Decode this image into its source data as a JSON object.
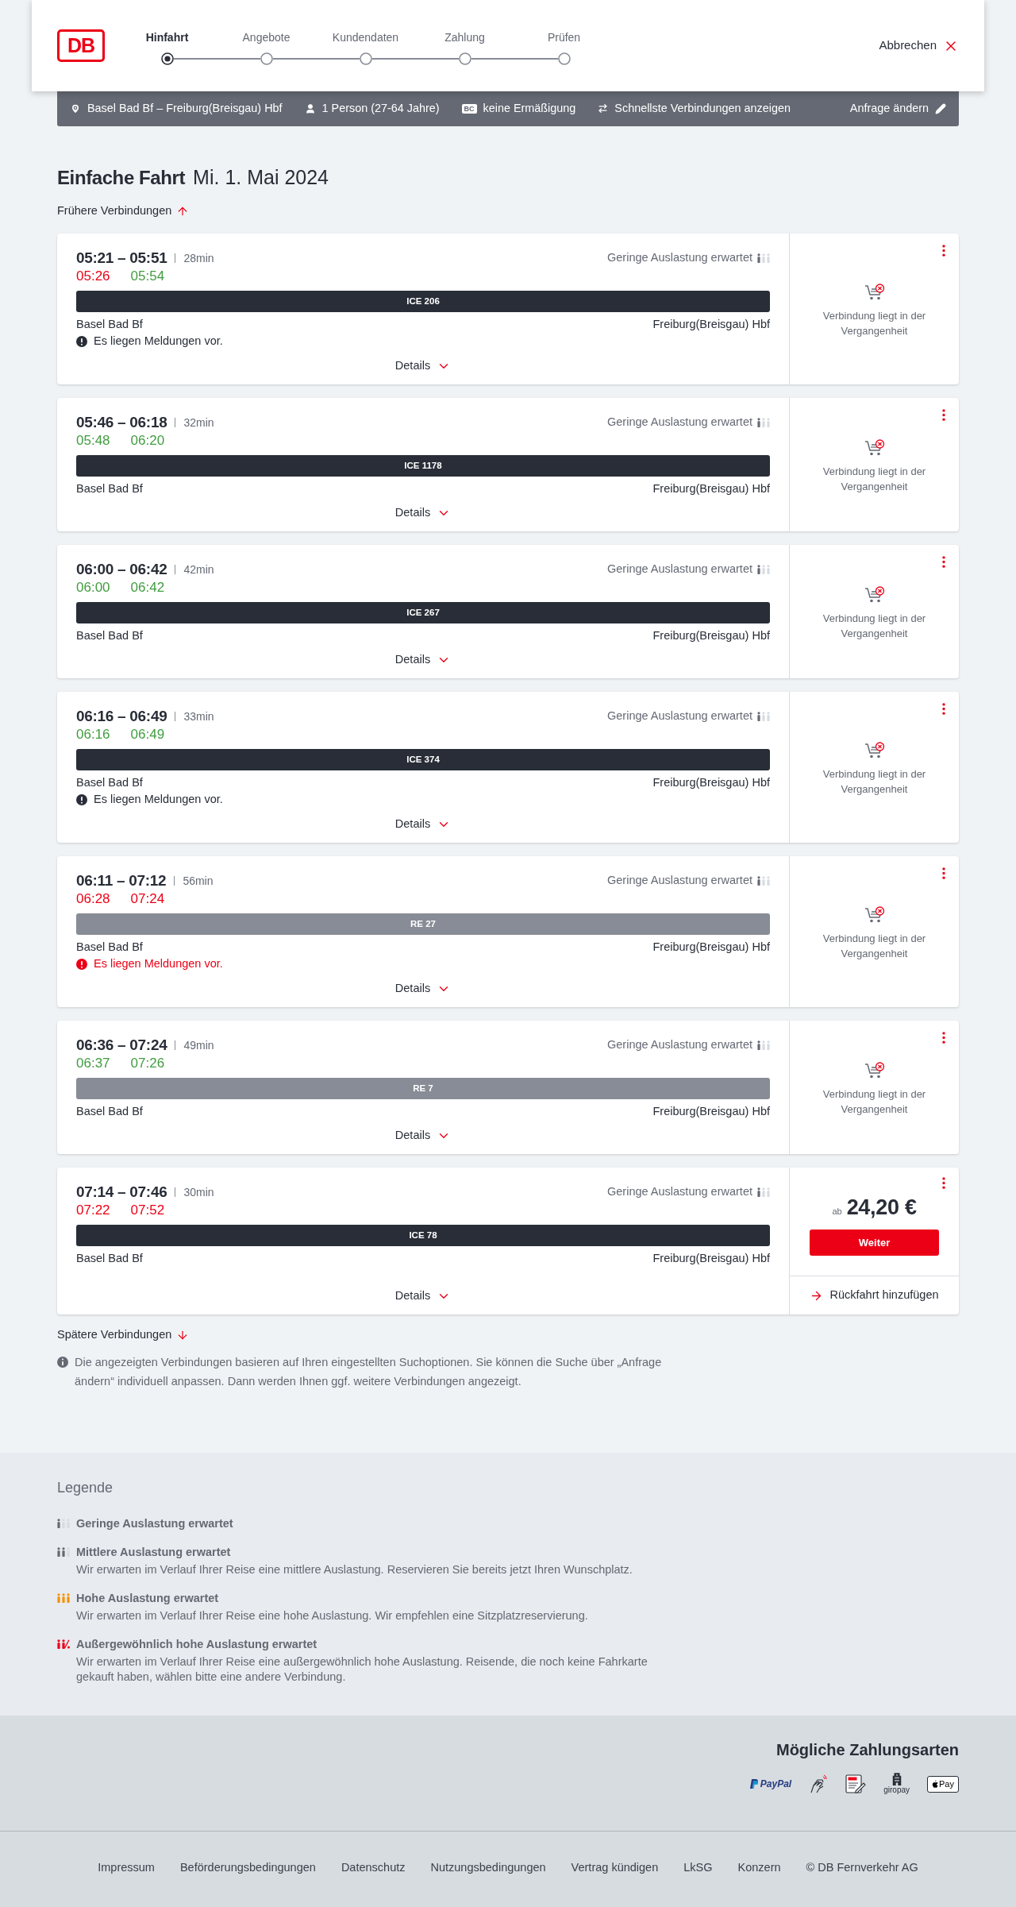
{
  "header": {
    "logo": "DB",
    "steps": [
      {
        "label": "Hinfahrt",
        "selected": true
      },
      {
        "label": "Angebote",
        "selected": false
      },
      {
        "label": "Kundendaten",
        "selected": false
      },
      {
        "label": "Zahlung",
        "selected": false
      },
      {
        "label": "Prüfen",
        "selected": false
      }
    ],
    "cancel": "Abbrechen"
  },
  "search_summary": {
    "route": "Basel Bad Bf – Freiburg(Breisgau) Hbf",
    "passengers": "1 Person (27-64 Jahre)",
    "discount_badge": "BC",
    "discount": "keine Ermäßigung",
    "option": "Schnellste Verbindungen anzeigen",
    "edit": "Anfrage ändern"
  },
  "heading": {
    "title": "Einfache Fahrt",
    "date": "Mi. 1. Mai 2024"
  },
  "earlier_link": "Frühere Verbindungen",
  "connections": [
    {
      "times": "05:21 – 05:51",
      "duration": "28min",
      "realtime": [
        {
          "time": "05:26",
          "late": true
        },
        {
          "time": "05:54",
          "late": false
        }
      ],
      "occupancy": {
        "kind": "low",
        "text": "Geringe Auslastung erwartet"
      },
      "train": {
        "kind": "long_distance",
        "label": "ICE 206"
      },
      "from": "Basel Bad Bf",
      "to": "Freiburg(Breisgau) Hbf",
      "message": {
        "text": "Es liegen Meldungen vor.",
        "alert": false
      },
      "details": "Details",
      "offer": {
        "kind": "past",
        "text": "Verbindung liegt in der Vergangenheit"
      }
    },
    {
      "times": "05:46 – 06:18",
      "duration": "32min",
      "realtime": [
        {
          "time": "05:48",
          "late": false
        },
        {
          "time": "06:20",
          "late": false
        }
      ],
      "occupancy": {
        "kind": "low",
        "text": "Geringe Auslastung erwartet"
      },
      "train": {
        "kind": "long_distance",
        "label": "ICE 1178"
      },
      "from": "Basel Bad Bf",
      "to": "Freiburg(Breisgau) Hbf",
      "details": "Details",
      "offer": {
        "kind": "past",
        "text": "Verbindung liegt in der Vergangenheit"
      }
    },
    {
      "times": "06:00 – 06:42",
      "duration": "42min",
      "realtime": [
        {
          "time": "06:00",
          "late": false
        },
        {
          "time": "06:42",
          "late": false
        }
      ],
      "occupancy": {
        "kind": "low",
        "text": "Geringe Auslastung erwartet"
      },
      "train": {
        "kind": "long_distance",
        "label": "ICE 267"
      },
      "from": "Basel Bad Bf",
      "to": "Freiburg(Breisgau) Hbf",
      "details": "Details",
      "offer": {
        "kind": "past",
        "text": "Verbindung liegt in der Vergangenheit"
      }
    },
    {
      "times": "06:16 – 06:49",
      "duration": "33min",
      "realtime": [
        {
          "time": "06:16",
          "late": false
        },
        {
          "time": "06:49",
          "late": false
        }
      ],
      "occupancy": {
        "kind": "low",
        "text": "Geringe Auslastung erwartet"
      },
      "train": {
        "kind": "long_distance",
        "label": "ICE 374"
      },
      "from": "Basel Bad Bf",
      "to": "Freiburg(Breisgau) Hbf",
      "message": {
        "text": "Es liegen Meldungen vor.",
        "alert": false
      },
      "details": "Details",
      "offer": {
        "kind": "past",
        "text": "Verbindung liegt in der Vergangenheit"
      }
    },
    {
      "times": "06:11 – 07:12",
      "duration": "56min",
      "realtime": [
        {
          "time": "06:28",
          "late": true
        },
        {
          "time": "07:24",
          "late": true
        }
      ],
      "occupancy": {
        "kind": "low",
        "text": "Geringe Auslastung erwartet"
      },
      "train": {
        "kind": "regional",
        "label": "RE 27"
      },
      "from": "Basel Bad Bf",
      "to": "Freiburg(Breisgau) Hbf",
      "message": {
        "text": "Es liegen Meldungen vor.",
        "alert": true
      },
      "details": "Details",
      "offer": {
        "kind": "past",
        "text": "Verbindung liegt in der Vergangenheit"
      }
    },
    {
      "times": "06:36 – 07:24",
      "duration": "49min",
      "realtime": [
        {
          "time": "06:37",
          "late": false
        },
        {
          "time": "07:26",
          "late": false
        }
      ],
      "occupancy": {
        "kind": "low",
        "text": "Geringe Auslastung erwartet"
      },
      "train": {
        "kind": "regional",
        "label": "RE 7"
      },
      "from": "Basel Bad Bf",
      "to": "Freiburg(Breisgau) Hbf",
      "details": "Details",
      "offer": {
        "kind": "past",
        "text": "Verbindung liegt in der Vergangenheit"
      }
    },
    {
      "times": "07:14 – 07:46",
      "duration": "30min",
      "realtime": [
        {
          "time": "07:22",
          "late": true
        },
        {
          "time": "07:52",
          "late": true
        }
      ],
      "occupancy": {
        "kind": "low",
        "text": "Geringe Auslastung erwartet"
      },
      "train": {
        "kind": "long_distance",
        "label": "ICE 78"
      },
      "from": "Basel Bad Bf",
      "to": "Freiburg(Breisgau) Hbf",
      "details": "Details",
      "offer": {
        "kind": "price",
        "prefix": "ab",
        "price": "24,20 €",
        "button": "Weiter",
        "return_link": "Rückfahrt hinzufügen"
      }
    }
  ],
  "later_link": "Spätere Verbindungen",
  "note": "Die angezeigten Verbindungen basieren auf Ihren eingestellten Suchoptionen. Sie können die Suche über „Anfrage ändern“ individuell anpassen. Dann werden Ihnen ggf. weitere Verbindungen angezeigt.",
  "legend": {
    "title": "Legende",
    "items": [
      {
        "kind": "low",
        "title": "Geringe Auslastung erwartet"
      },
      {
        "kind": "medium",
        "title": "Mittlere Auslastung erwartet",
        "description": "Wir erwarten im Verlauf Ihrer Reise eine mittlere Auslastung. Reservieren Sie bereits jetzt Ihren Wunschplatz."
      },
      {
        "kind": "high",
        "title": "Hohe Auslastung erwartet",
        "description": "Wir erwarten im Verlauf Ihrer Reise eine hohe Auslastung. Wir empfehlen eine Sitzplatzreservierung."
      },
      {
        "kind": "extreme",
        "title": "Außergewöhnlich hohe Auslastung erwartet",
        "description": "Wir erwarten im Verlauf Ihrer Reise eine außergewöhnlich hohe Auslastung. Reisende, die noch keine Fahrkarte gekauft haben, wählen bitte eine andere Verbindung."
      }
    ]
  },
  "footer": {
    "payment_title": "Mögliche Zahlungsarten",
    "payment_methods": [
      {
        "kind": "paypal",
        "label": "PayPal"
      },
      {
        "kind": "contactless"
      },
      {
        "kind": "sepa"
      },
      {
        "kind": "giropay",
        "label": "giropay"
      },
      {
        "kind": "applepay",
        "label": "Pay"
      }
    ],
    "links": [
      "Impressum",
      "Beförderungsbedingungen",
      "Datenschutz",
      "Nutzungsbedingungen",
      "Vertrag kündigen",
      "LkSG",
      "Konzern",
      "© DB Fernverkehr AG"
    ]
  }
}
